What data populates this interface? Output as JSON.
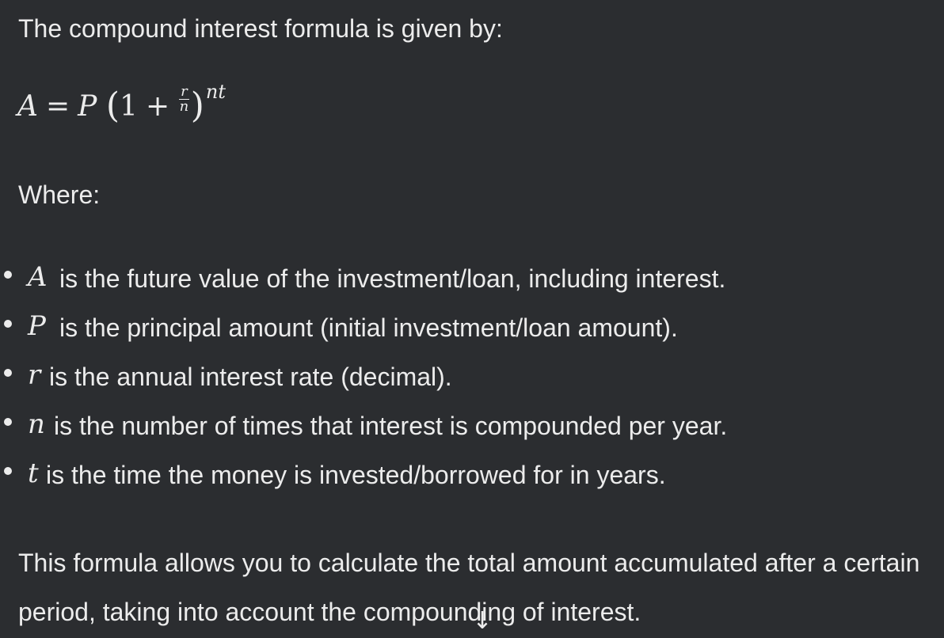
{
  "message": {
    "intro": "The compound interest formula is given by:",
    "formula": {
      "lhs": "A",
      "equals": "=",
      "principal": "P",
      "open_paren": "(",
      "one": "1",
      "plus": "+",
      "numerator": "r",
      "denominator": "n",
      "close_paren": ")",
      "exponent": "nt"
    },
    "where_label": "Where:",
    "definitions": [
      {
        "symbol": "A",
        "text": "is the future value of the investment/loan, including interest."
      },
      {
        "symbol": "P",
        "text": "is the principal amount (initial investment/loan amount)."
      },
      {
        "symbol": "r",
        "text": "is the annual interest rate (decimal)."
      },
      {
        "symbol": "n",
        "text": "is the number of times that interest is compounded per year."
      },
      {
        "symbol": "t",
        "text": "is the time the money is invested/borrowed for in years."
      }
    ],
    "summary": "This formula allows you to calculate the total amount accumulated after a certain period, taking into account the compounding of interest."
  },
  "scroll_button": {
    "icon": "arrow-down-icon",
    "glyph": "↓"
  },
  "colors": {
    "background": "#2b2d30",
    "text": "#ececec"
  }
}
